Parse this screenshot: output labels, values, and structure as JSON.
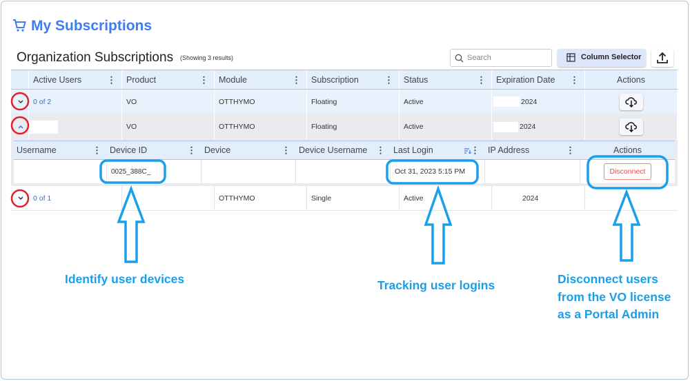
{
  "header": {
    "title": "My Subscriptions",
    "icon": "cart-icon"
  },
  "section": {
    "title": "Organization Subscriptions",
    "count": "(Showing 3 results)"
  },
  "toolbar": {
    "search_placeholder": "Search",
    "column_selector": "Column Selector"
  },
  "table": {
    "columns": [
      "Active Users",
      "Product",
      "Module",
      "Subscription",
      "Status",
      "Expiration Date",
      "Actions"
    ],
    "rows": [
      {
        "active_users": "0 of 2",
        "product": "VO",
        "module": "OTTHYMO",
        "subscription": "Floating",
        "status": "Active",
        "expiration": "2024"
      },
      {
        "active_users": "",
        "product": "VO",
        "module": "OTTHYMO",
        "subscription": "Floating",
        "status": "Active",
        "expiration": "2024"
      },
      {
        "active_users": "0 of 1",
        "product": "",
        "module": "OTTHYMO",
        "subscription": "Single",
        "status": "Active",
        "expiration": "2024"
      }
    ]
  },
  "subtable": {
    "columns": [
      "Username",
      "Device ID",
      "Device",
      "Device Username",
      "Last Login",
      "IP Address",
      "Actions"
    ],
    "row": {
      "username": "",
      "device_id": "0025_388C_",
      "device": "",
      "device_username": "",
      "last_login": "Oct 31, 2023 5:15 PM",
      "ip": "",
      "action": "Disconnect"
    }
  },
  "annotations": {
    "devices": "Identify user devices",
    "logins": "Tracking user logins",
    "disconnect": [
      "Disconnect users",
      "from the VO license",
      "as a Portal Admin"
    ]
  },
  "colors": {
    "accent": "#3d7df0",
    "annotation": "#1a9ee8",
    "highlight_red": "#e02020"
  }
}
